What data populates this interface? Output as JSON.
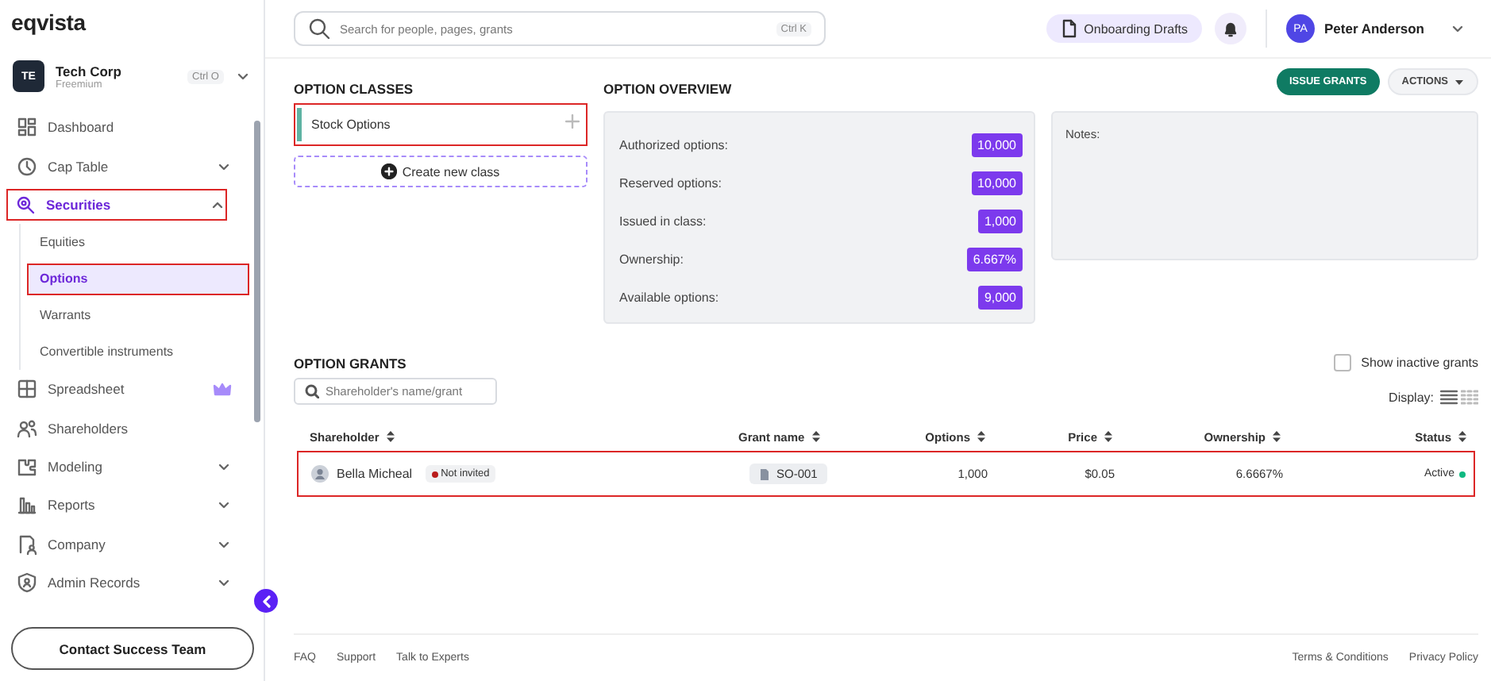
{
  "brand": "eqvista",
  "company": {
    "initials": "TE",
    "name": "Tech Corp",
    "plan": "Freemium",
    "shortcut": "Ctrl O"
  },
  "sidebar": {
    "items": [
      {
        "label": "Dashboard",
        "kind": "link",
        "selected": false
      },
      {
        "label": "Cap Table",
        "kind": "group",
        "selected": false,
        "expanded": false
      },
      {
        "label": "Securities",
        "kind": "group",
        "selected": true,
        "expanded": true,
        "highlighted": true,
        "children": [
          {
            "label": "Equities",
            "selected": false,
            "highlighted": false
          },
          {
            "label": "Options",
            "selected": true,
            "highlighted": true
          },
          {
            "label": "Warrants",
            "selected": false,
            "highlighted": false
          },
          {
            "label": "Convertible instruments",
            "selected": false,
            "highlighted": false
          }
        ]
      },
      {
        "label": "Spreadsheet",
        "kind": "link",
        "selected": false,
        "premium": true
      },
      {
        "label": "Shareholders",
        "kind": "link",
        "selected": false
      },
      {
        "label": "Modeling",
        "kind": "group",
        "selected": false,
        "expanded": false
      },
      {
        "label": "Reports",
        "kind": "group",
        "selected": false,
        "expanded": false
      },
      {
        "label": "Company",
        "kind": "group",
        "selected": false,
        "expanded": false
      },
      {
        "label": "Admin Records",
        "kind": "group",
        "selected": false,
        "expanded": false
      }
    ],
    "contact_button": "Contact Success Team"
  },
  "topbar": {
    "search": {
      "placeholder": "Search for people, pages, grants",
      "shortcut": "Ctrl K"
    },
    "drafts_button": "Onboarding Drafts",
    "user": {
      "initials": "PA",
      "name": "Peter Anderson"
    }
  },
  "option_classes": {
    "title": "OPTION CLASSES",
    "items": [
      {
        "label": "Stock Options",
        "color": "#5fb3a3",
        "highlighted": true
      }
    ],
    "create_button": "Create new class"
  },
  "overview": {
    "title": "OPTION OVERVIEW",
    "rows": [
      {
        "label": "Authorized options:",
        "value": "10,000"
      },
      {
        "label": "Reserved options:",
        "value": "10,000"
      },
      {
        "label": "Issued in class:",
        "value": "1,000"
      },
      {
        "label": "Ownership:",
        "value": "6.667%"
      },
      {
        "label": "Available options:",
        "value": "9,000"
      }
    ]
  },
  "notes": {
    "label": "Notes:"
  },
  "actions": {
    "issue_button": "ISSUE GRANTS",
    "actions_button": "ACTIONS"
  },
  "grants": {
    "title": "OPTION GRANTS",
    "show_inactive": {
      "label": "Show inactive grants",
      "checked": false
    },
    "search": {
      "placeholder": "Shareholder's name/grant"
    },
    "display_label": "Display:",
    "views": [
      {
        "kind": "list",
        "selected": true
      },
      {
        "kind": "grid",
        "selected": false
      }
    ],
    "columns": [
      "Shareholder",
      "Grant name",
      "Options",
      "Price",
      "Ownership",
      "Status"
    ],
    "rows": [
      {
        "shareholder": "Bella Micheal",
        "invite": {
          "label": "Not invited",
          "color": "#b91c1c"
        },
        "grant_name": "SO-001",
        "options": "1,000",
        "price": "$0.05",
        "ownership": "6.6667%",
        "status": {
          "label": "Active",
          "color": "#10b981"
        },
        "highlighted": true
      }
    ]
  },
  "footer": {
    "left_links": [
      "FAQ",
      "Support",
      "Talk to Experts"
    ],
    "right_links": [
      "Terms & Conditions",
      "Privacy Policy"
    ]
  }
}
